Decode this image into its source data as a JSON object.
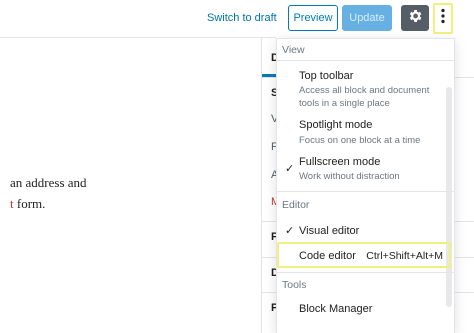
{
  "toolbar": {
    "switch_to_draft": "Switch to draft",
    "preview_label": "Preview",
    "update_label": "Update",
    "settings_icon": "gear-icon",
    "more_icon": "more-vertical-icon"
  },
  "content": {
    "line1": "an address and",
    "line2_link": "t",
    "line2_rest": " form."
  },
  "sidebar": {
    "tab_fragment": "D",
    "frag_1": "S",
    "frag_2": "V",
    "frag_3": "F",
    "frag_4": "A",
    "frag_5": "M",
    "frag_6": "P",
    "frag_7": "D",
    "frag_8": "P"
  },
  "menu": {
    "view_heading": "View",
    "top_toolbar_label": "Top toolbar",
    "top_toolbar_desc": "Access all block and document tools in a single place",
    "spotlight_label": "Spotlight mode",
    "spotlight_desc": "Focus on one block at a time",
    "fullscreen_label": "Fullscreen mode",
    "fullscreen_desc": "Work without distraction",
    "editor_heading": "Editor",
    "visual_editor_label": "Visual editor",
    "code_editor_label": "Code editor",
    "code_editor_shortcut": "Ctrl+Shift+Alt+M",
    "tools_heading": "Tools",
    "block_manager_label": "Block Manager",
    "check_glyph": "✓"
  },
  "colors": {
    "accent": "#007cba",
    "highlight": "#f0f07d",
    "update_disabled": "#66b0e3",
    "gear_bg": "#555d66"
  }
}
